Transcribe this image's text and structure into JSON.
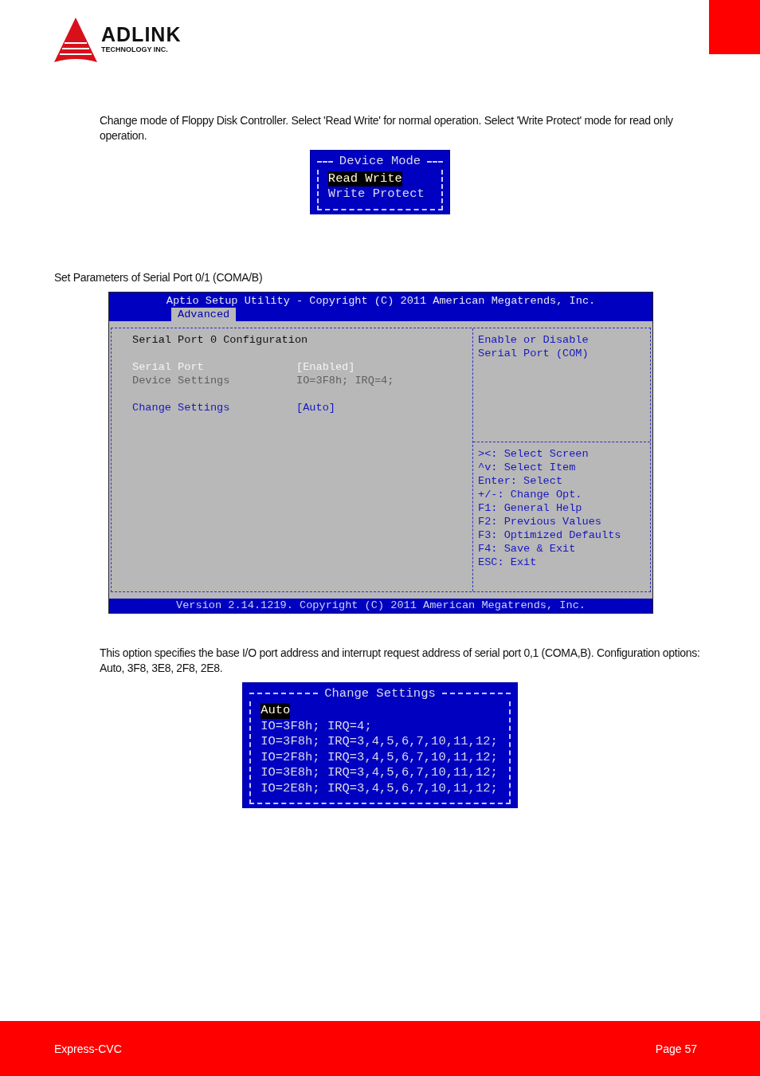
{
  "header": {
    "logo_name": "ADLINK",
    "logo_tagline": "TECHNOLOGY INC."
  },
  "sections": [
    {
      "description": "Change mode of Floppy Disk Controller. Select 'Read Write' for normal operation. Select 'Write Protect' mode for read only operation.",
      "kind": "popup",
      "popup": {
        "title": "Device Mode",
        "items": [
          {
            "label": "Read Write",
            "selected": true
          },
          {
            "label": "Write Protect",
            "selected": false
          }
        ]
      }
    },
    {
      "description": "Set Parameters of Serial Port 0/1 (COMA/B)",
      "kind": "setup",
      "setup": {
        "title": "Aptio Setup Utility - Copyright (C) 2011 American Megatrends, Inc.",
        "tabs": [
          {
            "label": "Advanced",
            "selected": true
          }
        ],
        "heading": "Serial Port 0 Configuration",
        "rows": [
          {
            "label": "Serial Port",
            "value": "[Enabled]",
            "kind": "inactive"
          },
          {
            "label": "Device Settings",
            "value": "IO=3F8h; IRQ=4;",
            "kind": "info"
          },
          {
            "label": "Change Settings",
            "value": "[Auto]",
            "kind": "option",
            "gap_before": true
          }
        ],
        "help": [
          "Enable or Disable",
          "Serial Port (COM)"
        ],
        "keys": [
          "><: Select Screen",
          "^v: Select Item",
          "Enter: Select",
          "+/-: Change Opt.",
          "F1: General Help",
          "F2: Previous Values",
          "F3: Optimized Defaults",
          "F4: Save & Exit",
          "ESC: Exit"
        ],
        "footer": "Version 2.14.1219. Copyright (C) 2011 American Megatrends, Inc."
      }
    },
    {
      "description": "This option specifies the base I/O port address and interrupt request address of serial port 0,1 (COMA,B). Configuration options: Auto, 3F8, 3E8, 2F8, 2E8.",
      "kind": "popup",
      "popup": {
        "title": "Change Settings",
        "items": [
          {
            "label": "Auto",
            "selected": true
          },
          {
            "label": "IO=3F8h; IRQ=4;",
            "selected": false
          },
          {
            "label": "IO=3F8h; IRQ=3,4,5,6,7,10,11,12;",
            "selected": false
          },
          {
            "label": "IO=2F8h; IRQ=3,4,5,6,7,10,11,12;",
            "selected": false
          },
          {
            "label": "IO=3E8h; IRQ=3,4,5,6,7,10,11,12;",
            "selected": false
          },
          {
            "label": "IO=2E8h; IRQ=3,4,5,6,7,10,11,12;",
            "selected": false
          }
        ]
      }
    }
  ],
  "footer": {
    "product": "Express-CVC",
    "page": "Page 57"
  }
}
